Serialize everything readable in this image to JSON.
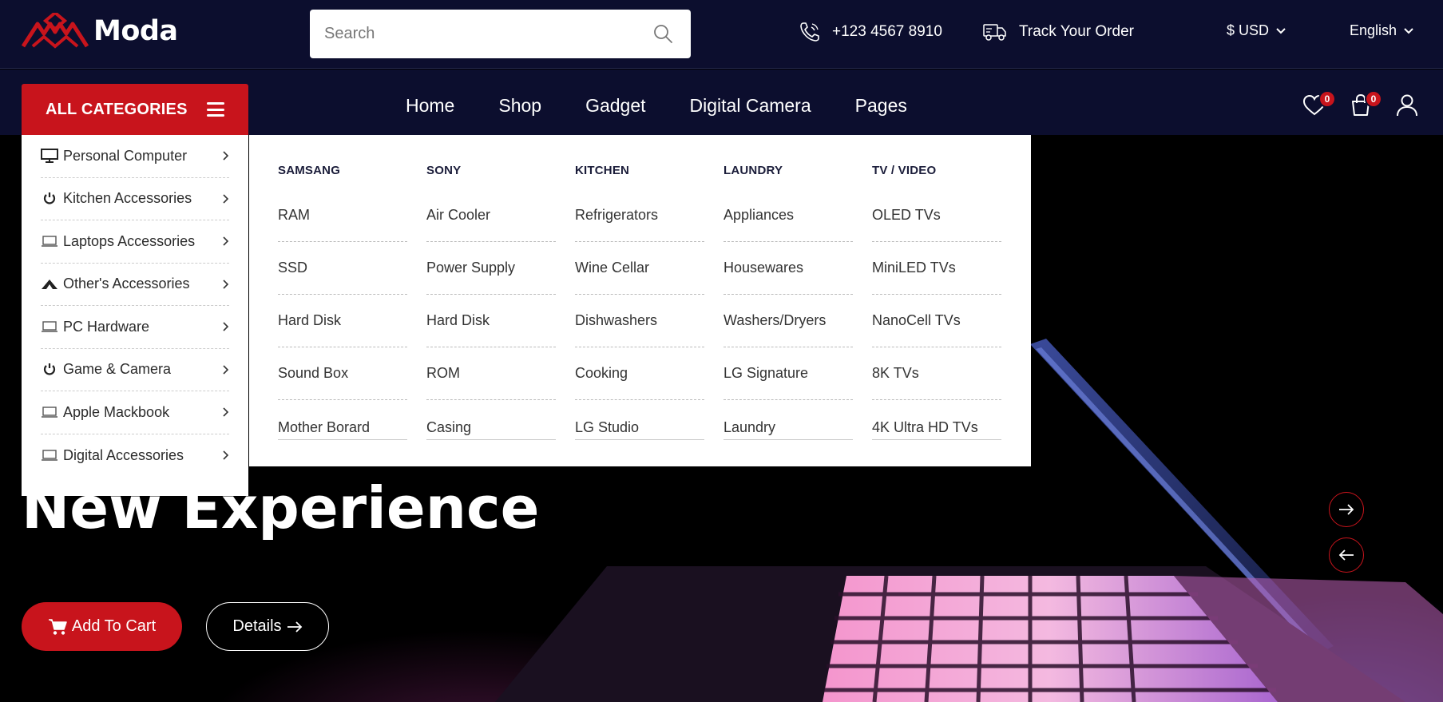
{
  "brand": {
    "name": "Moda",
    "accent": "#c8141c",
    "navy": "#0c0e2e"
  },
  "search": {
    "placeholder": "Search"
  },
  "topbar": {
    "phone": "+123 4567 8910",
    "track": "Track Your Order",
    "currency": "$ USD",
    "language": "English"
  },
  "nav": {
    "all_categories": "ALL CATEGORIES",
    "links": [
      "Home",
      "Shop",
      "Gadget",
      "Digital Camera",
      "Pages"
    ],
    "wishlist_count": "0",
    "cart_count": "0"
  },
  "categories": [
    {
      "label": "Personal Computer",
      "icon": "monitor-icon"
    },
    {
      "label": "Kitchen Accessories",
      "icon": "power-icon"
    },
    {
      "label": "Laptops Accessories",
      "icon": "laptop-icon"
    },
    {
      "label": "Other's Accessories",
      "icon": "arrow-shape-icon"
    },
    {
      "label": "PC Hardware",
      "icon": "laptop-icon"
    },
    {
      "label": "Game & Camera",
      "icon": "power-icon"
    },
    {
      "label": "Apple Mackbook",
      "icon": "laptop-icon"
    },
    {
      "label": "Digital Accessories",
      "icon": "laptop-icon"
    }
  ],
  "mega": [
    {
      "heading": "SAMSANG",
      "items": [
        "RAM",
        "SSD",
        "Hard Disk",
        "Sound Box",
        "Mother Borard"
      ]
    },
    {
      "heading": "SONY",
      "items": [
        "Air Cooler",
        "Power Supply",
        "Hard Disk",
        "ROM",
        "Casing"
      ]
    },
    {
      "heading": "KITCHEN",
      "items": [
        "Refrigerators",
        "Wine Cellar",
        "Dishwashers",
        "Cooking",
        "LG Studio"
      ]
    },
    {
      "heading": "LAUNDRY",
      "items": [
        "Appliances",
        "Housewares",
        "Washers/Dryers",
        "LG Signature",
        "Laundry"
      ]
    },
    {
      "heading": "TV / VIDEO",
      "items": [
        "OLED TVs",
        "MiniLED TVs",
        "NanoCell TVs",
        "8K TVs",
        "4K Ultra HD TVs"
      ]
    }
  ],
  "hero": {
    "title": "New Experience",
    "add_to_cart": "Add To Cart",
    "details": "Details"
  }
}
